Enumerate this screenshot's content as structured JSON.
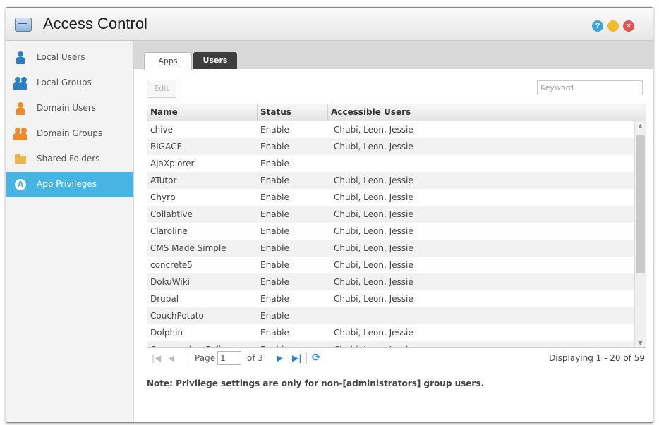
{
  "window": {
    "title": "Access Control",
    "help_glyph": "?",
    "close_glyph": "×"
  },
  "sidebar": {
    "items": [
      {
        "label": "Local Users",
        "icon": "user-icon"
      },
      {
        "label": "Local Groups",
        "icon": "group-icon"
      },
      {
        "label": "Domain Users",
        "icon": "domain-user-icon"
      },
      {
        "label": "Domain Groups",
        "icon": "domain-group-icon"
      },
      {
        "label": "Shared Folders",
        "icon": "folder-icon"
      },
      {
        "label": "App Privileges",
        "icon": "app-privileges-icon",
        "active": true
      }
    ]
  },
  "tabs": {
    "apps": "Apps",
    "users": "Users"
  },
  "toolbar": {
    "edit_label": "Edit",
    "keyword_placeholder": "Keyword"
  },
  "table": {
    "headers": [
      "Name",
      "Status",
      "Accessible Users"
    ],
    "rows": [
      {
        "name": "chive",
        "status": "Enable",
        "users": "Chubi, Leon, Jessie"
      },
      {
        "name": "BIGACE",
        "status": "Enable",
        "users": "Chubi, Leon, Jessie"
      },
      {
        "name": "AjaXplorer",
        "status": "Enable",
        "users": ""
      },
      {
        "name": "ATutor",
        "status": "Enable",
        "users": "Chubi, Leon, Jessie"
      },
      {
        "name": "Chyrp",
        "status": "Enable",
        "users": "Chubi, Leon, Jessie"
      },
      {
        "name": "Collabtive",
        "status": "Enable",
        "users": "Chubi, Leon, Jessie"
      },
      {
        "name": "Claroline",
        "status": "Enable",
        "users": "Chubi, Leon, Jessie"
      },
      {
        "name": "CMS Made Simple",
        "status": "Enable",
        "users": "Chubi, Leon, Jessie"
      },
      {
        "name": "concrete5",
        "status": "Enable",
        "users": "Chubi, Leon, Jessie"
      },
      {
        "name": "DokuWiki",
        "status": "Enable",
        "users": "Chubi, Leon, Jessie"
      },
      {
        "name": "Drupal",
        "status": "Enable",
        "users": "Chubi, Leon, Jessie"
      },
      {
        "name": "CouchPotato",
        "status": "Enable",
        "users": ""
      },
      {
        "name": "Dolphin",
        "status": "Enable",
        "users": "Chubi, Leon, Jessie"
      },
      {
        "name": "Coppermine Gallery",
        "status": "Enable",
        "users": "Chubi, Leon, Jessie"
      }
    ]
  },
  "pager": {
    "page_label": "Page",
    "page_value": "1",
    "of_label": "of 3",
    "display_text": "Displaying 1 - 20 of 59"
  },
  "note": "Note: Privilege settings are only for non-[administrators] group users.",
  "colors": {
    "accent": "#46b5e3",
    "tab_active": "#3d3d3d",
    "help_button": "#3aa4dd",
    "minimize_button": "#f1bd2b",
    "close_button": "#e25252"
  }
}
